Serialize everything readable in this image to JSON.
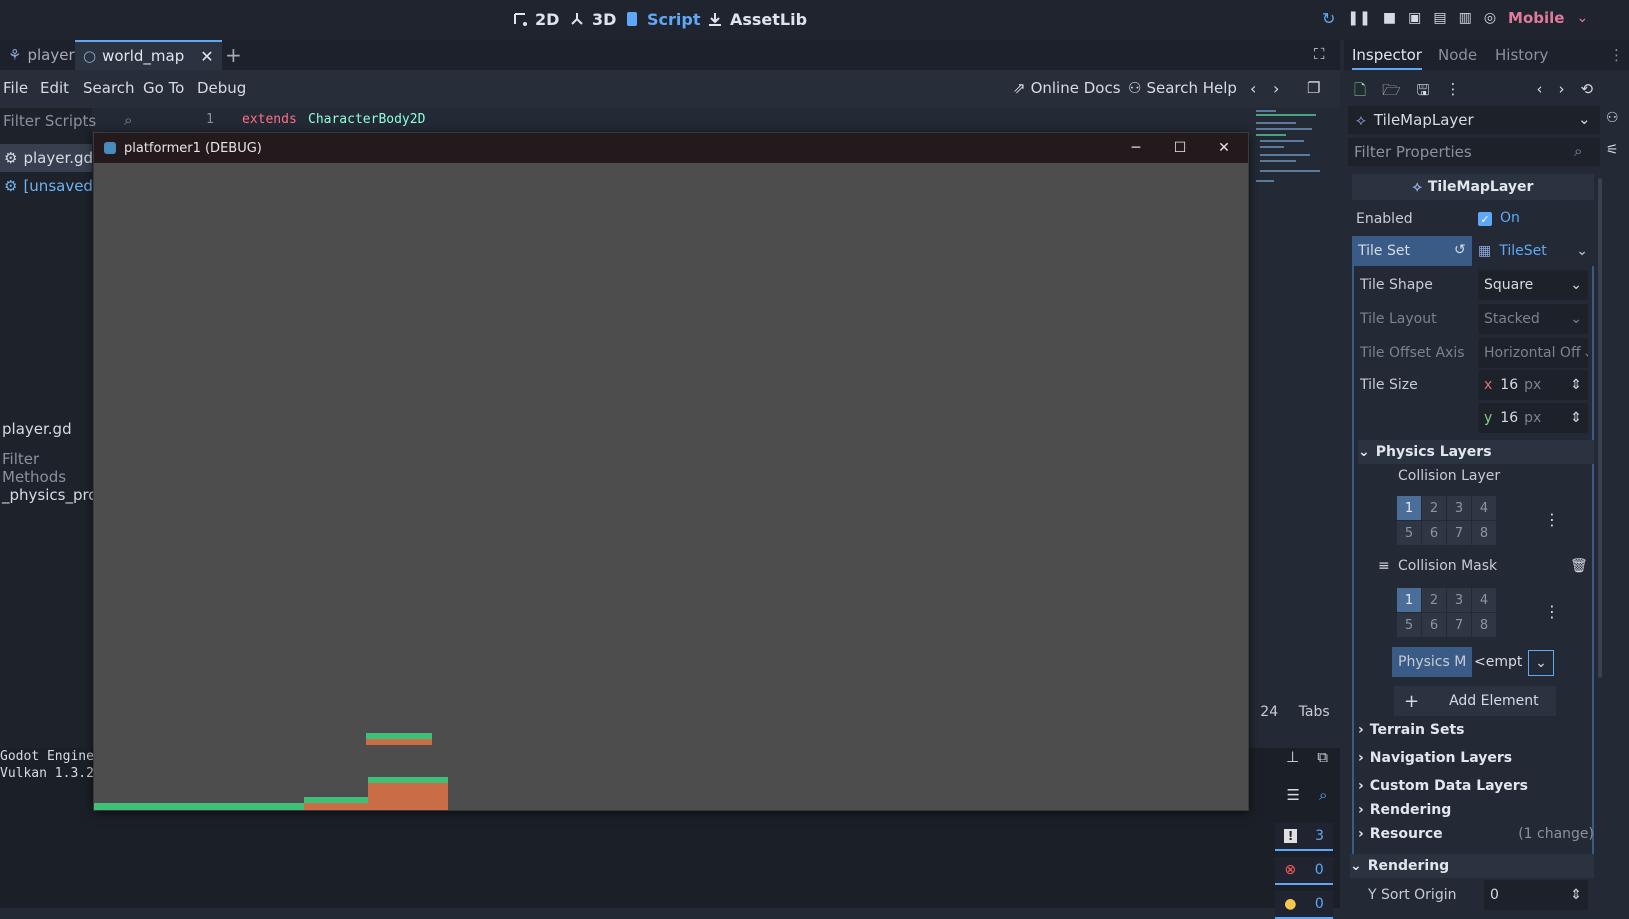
{
  "topbar": {
    "tabs": [
      {
        "label": "2D",
        "icon": "2d-icon"
      },
      {
        "label": "3D",
        "icon": "3d-icon"
      },
      {
        "label": "Script",
        "icon": "script-icon"
      },
      {
        "label": "AssetLib",
        "icon": "assetlib-icon"
      }
    ],
    "renderer": "Mobile",
    "accent": "#5fa8f5"
  },
  "doc_tabs": [
    {
      "label": "player",
      "icon": "scene-icon"
    },
    {
      "label": "world_map",
      "icon": "node-circle-icon"
    }
  ],
  "menu": [
    "File",
    "Edit",
    "Search",
    "Go To",
    "Debug"
  ],
  "help": {
    "online_docs": "Online Docs",
    "search_help": "Search Help"
  },
  "scripts": {
    "filter_placeholder": "Filter Scripts",
    "items": [
      "player.gd",
      "[unsaved](*)"
    ],
    "current": "player.gd",
    "filter_methods_placeholder": "Filter Methods",
    "methods": [
      "_physics_process"
    ]
  },
  "editor": {
    "line_no": "1",
    "keyword": "extends",
    "class_name": "CharacterBody2D",
    "keyword_color": "#ff7085",
    "class_color": "#8effda"
  },
  "debug_window": {
    "title": "platformer1 (DEBUG)",
    "background": "#4d4d4d"
  },
  "output": [
    "Godot Engine",
    "Vulkan 1.3.2"
  ],
  "statusbar": {
    "col": "24",
    "indent": "Tabs"
  },
  "counts": {
    "warnings": "3",
    "errors": "0",
    "info": "0"
  },
  "inspector": {
    "tabs": [
      "Inspector",
      "Node",
      "History"
    ],
    "node_name": "TileMapLayer",
    "filter_placeholder": "Filter Properties",
    "header": "TileMapLayer",
    "enabled_label": "Enabled",
    "enabled_value": "On",
    "tileset_label": "Tile Set",
    "tileset_value": "TileSet",
    "props": [
      {
        "label": "Tile Shape",
        "value": "Square"
      },
      {
        "label": "Tile Layout",
        "value": "Stacked"
      },
      {
        "label": "Tile Offset Axis",
        "value": "Horizontal Off"
      }
    ],
    "tile_size_label": "Tile Size",
    "tile_size_x": "16",
    "tile_size_y": "16",
    "px_unit": "px",
    "physics_layers": "Physics Layers",
    "collision_layer": "Collision Layer",
    "collision_mask": "Collision Mask",
    "layer_numbers": [
      "1",
      "2",
      "3",
      "4",
      "5",
      "6",
      "7",
      "8"
    ],
    "physics_material_label": "Physics M",
    "physics_material_value": "<empt",
    "add_element": "Add Element",
    "sections": [
      "Terrain Sets",
      "Navigation Layers",
      "Custom Data Layers",
      "Rendering"
    ],
    "resource_label": "Resource",
    "resource_change": "(1 change)",
    "rendering_label": "Rendering",
    "y_sort_label": "Y Sort Origin",
    "y_sort_value": "0"
  }
}
